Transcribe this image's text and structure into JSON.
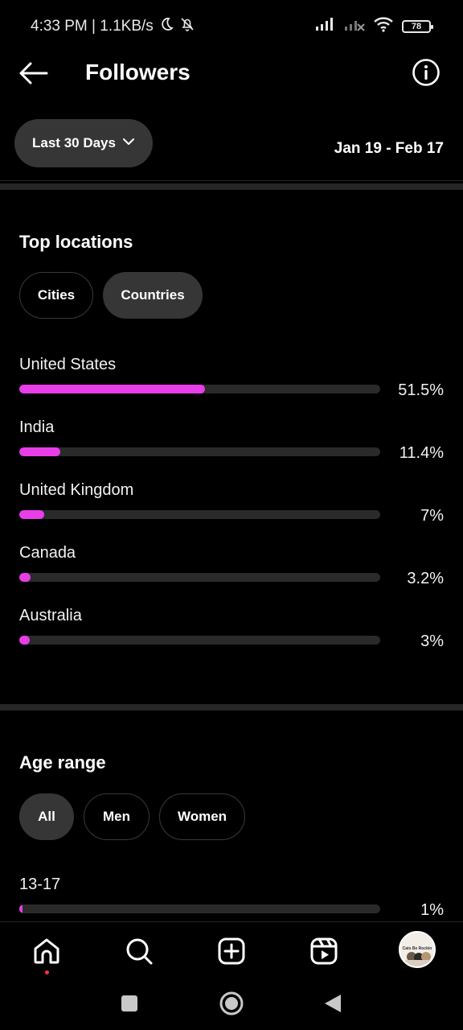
{
  "status_bar": {
    "time_speed": "4:33 PM | 1.1KB/s",
    "battery": "78"
  },
  "header": {
    "title": "Followers"
  },
  "range": {
    "selected": "Last 30 Days",
    "dates": "Jan 19 - Feb 17"
  },
  "top_locations": {
    "title": "Top locations",
    "chips": [
      "Cities",
      "Countries"
    ],
    "active_chip": "Countries",
    "accent_color": "#e83ee8",
    "items": [
      {
        "label": "United States",
        "value": "51.5%",
        "fraction": 0.515
      },
      {
        "label": "India",
        "value": "11.4%",
        "fraction": 0.114
      },
      {
        "label": "United Kingdom",
        "value": "7%",
        "fraction": 0.07
      },
      {
        "label": "Canada",
        "value": "3.2%",
        "fraction": 0.032
      },
      {
        "label": "Australia",
        "value": "3%",
        "fraction": 0.03
      }
    ]
  },
  "age_range": {
    "title": "Age range",
    "chips": [
      "All",
      "Men",
      "Women"
    ],
    "active_chip": "All",
    "items": [
      {
        "label": "13-17",
        "value": "1%",
        "fraction": 0.01
      }
    ]
  },
  "bottom_nav": {
    "items": [
      "home-icon",
      "search-icon",
      "create-icon",
      "reels-icon",
      "profile-avatar"
    ],
    "avatar_text": "Cats Be Rockin"
  }
}
